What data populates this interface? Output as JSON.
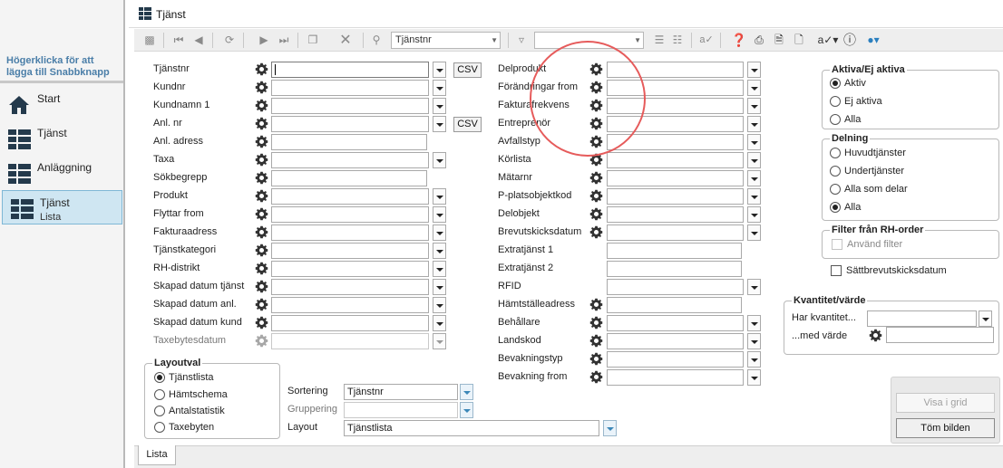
{
  "sidebar": {
    "hint": "Högerklicka för att lägga till Snabbknapp",
    "items": [
      {
        "label": "Start",
        "sub": "",
        "icon": "home-icon"
      },
      {
        "label": "Tjänst",
        "sub": "",
        "icon": "grid-icon"
      },
      {
        "label": "Anläggning",
        "sub": "",
        "icon": "grid-icon"
      },
      {
        "label": "Tjänst",
        "sub": "Lista",
        "icon": "grid-icon",
        "active": true
      }
    ]
  },
  "window": {
    "title": "Tjänst"
  },
  "toolbar": {
    "search_field": "Tjänstnr",
    "filter_field": "",
    "icons": [
      "export-icon",
      "first-record-icon",
      "previous-record-icon",
      "refresh-icon",
      "next-record-icon",
      "last-record-icon",
      "new-record-icon",
      "delete-icon",
      "search-icon",
      "filter-icon",
      "filter-options-icon",
      "clear-filter-icon",
      "spellcheck-icon",
      "help-icon",
      "print-icon",
      "print-preview-icon",
      "export-doc-icon",
      "signature-icon",
      "info-icon",
      "globe-icon"
    ]
  },
  "form": {
    "left_fields": [
      {
        "label": "Tjänstnr",
        "dropdown": true,
        "csv": "CSV"
      },
      {
        "label": "Kundnr",
        "dropdown": true
      },
      {
        "label": "Kundnamn 1",
        "dropdown": true
      },
      {
        "label": "Anl. nr",
        "dropdown": true,
        "csv": "CSV"
      },
      {
        "label": "Anl. adress",
        "dropdown": false
      },
      {
        "label": "Taxa",
        "dropdown": true
      },
      {
        "label": "Sökbegrepp",
        "dropdown": false
      },
      {
        "label": "Produkt",
        "dropdown": true
      },
      {
        "label": "Flyttar from",
        "dropdown": true
      },
      {
        "label": "Fakturaadress",
        "dropdown": true
      },
      {
        "label": "Tjänstkategori",
        "dropdown": true
      },
      {
        "label": "RH-distrikt",
        "dropdown": true
      },
      {
        "label": "Skapad datum tjänst",
        "dropdown": true
      },
      {
        "label": "Skapad datum anl.",
        "dropdown": true
      },
      {
        "label": "Skapad datum kund",
        "dropdown": true
      },
      {
        "label": "Taxebytesdatum",
        "dropdown": true,
        "disabled": true
      }
    ],
    "middle_fields": [
      {
        "label": "Delprodukt",
        "dropdown": true
      },
      {
        "label": "Förändringar from",
        "dropdown": true
      },
      {
        "label": "Fakturafrekvens",
        "dropdown": true
      },
      {
        "label": "Entreprenör",
        "dropdown": true
      },
      {
        "label": "Avfallstyp",
        "dropdown": true
      },
      {
        "label": "Körlista",
        "dropdown": true
      },
      {
        "label": "Mätarnr",
        "dropdown": true
      },
      {
        "label": "P-platsobjektkod",
        "dropdown": true
      },
      {
        "label": "Delobjekt",
        "dropdown": true
      },
      {
        "label": "Brevutskicksdatum",
        "dropdown": true
      },
      {
        "label": "Extratjänst 1",
        "dropdown": false,
        "gear": false
      },
      {
        "label": "Extratjänst 2",
        "dropdown": false,
        "gear": false
      },
      {
        "label": "RFID",
        "dropdown": true,
        "gear": false
      },
      {
        "label": "Hämtställeadress",
        "dropdown": false
      },
      {
        "label": "Behållare",
        "dropdown": true
      },
      {
        "label": "Landskod",
        "dropdown": true
      },
      {
        "label": "Bevakningstyp",
        "dropdown": true
      },
      {
        "label": "Bevakning from",
        "dropdown": true
      }
    ],
    "aktiva": {
      "title": "Aktiva/Ej aktiva",
      "options": [
        "Aktiv",
        "Ej aktiva",
        "Alla"
      ],
      "selected": "Aktiv"
    },
    "delning": {
      "title": "Delning",
      "options": [
        "Huvudtjänster",
        "Undertjänster",
        "Alla som delar",
        "Alla"
      ],
      "selected": "Alla"
    },
    "rh_filter": {
      "title": "Filter från RH-order",
      "checkbox": "Använd filter"
    },
    "satt_brev": "Sättbrevutskicksdatum",
    "kvantitet": {
      "title": "Kvantitet/värde",
      "har_label": "Har kvantitet...",
      "med_label": "...med värde"
    },
    "layoutval": {
      "title": "Layoutval",
      "options": [
        "Tjänstlista",
        "Hämtschema",
        "Antalstatistik",
        "Taxebyten"
      ],
      "selected": "Tjänstlista"
    },
    "sortering": {
      "label": "Sortering",
      "value": "Tjänstnr"
    },
    "gruppering": {
      "label": "Gruppering",
      "value": ""
    },
    "layout": {
      "label": "Layout",
      "value": "Tjänstlista"
    },
    "buttons": {
      "visa": "Visa i grid",
      "tom": "Töm bilden"
    }
  },
  "tabs": [
    {
      "label": "Lista"
    }
  ],
  "colors": {
    "accent": "#3b87b8",
    "highlight": "#e65b5b",
    "nav_active": "#cfe6f2"
  }
}
